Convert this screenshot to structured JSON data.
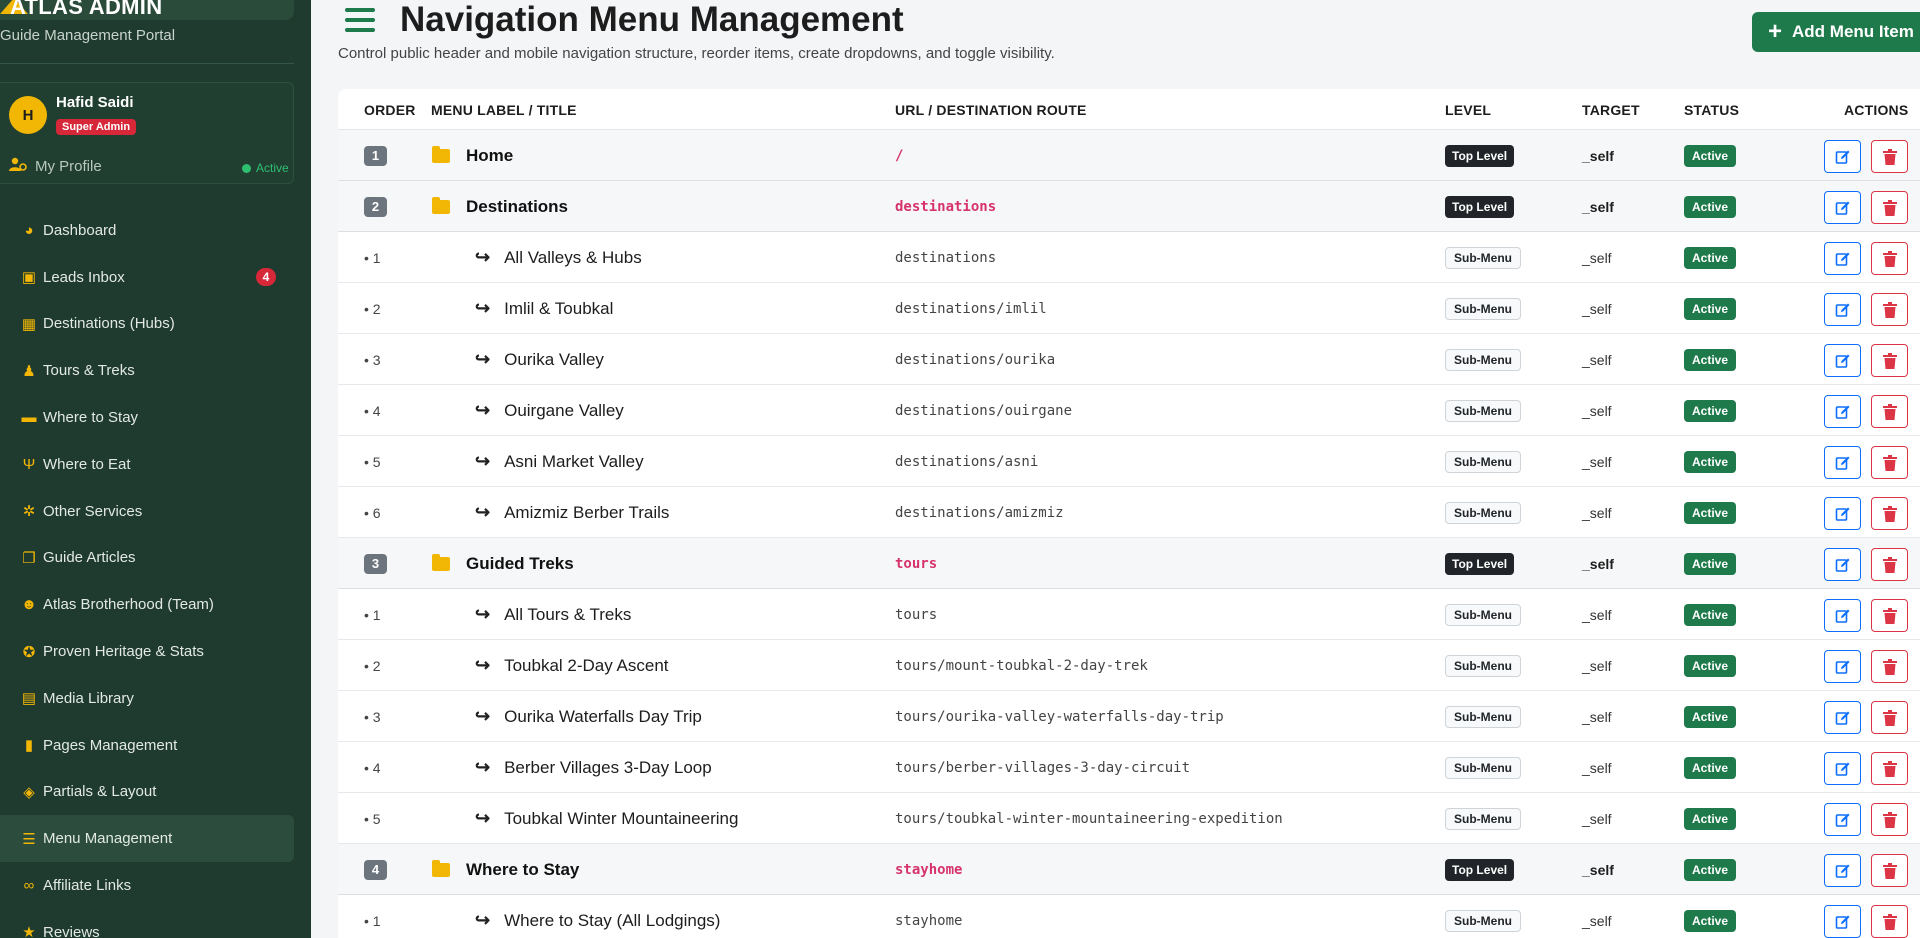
{
  "sidebar": {
    "brand": "ATLAS ADMIN",
    "subtitle": "Guide Management Portal",
    "profile": {
      "initial": "H",
      "name": "Hafid Saidi",
      "role": "Super Admin",
      "link": "My Profile",
      "status": "Active"
    },
    "items": [
      {
        "label": "Dashboard",
        "icon": "palette-icon"
      },
      {
        "label": "Leads Inbox",
        "icon": "inbox-icon",
        "badge": "4"
      },
      {
        "label": "Destinations (Hubs)",
        "icon": "map-icon"
      },
      {
        "label": "Tours & Treks",
        "icon": "hiker-icon"
      },
      {
        "label": "Where to Stay",
        "icon": "bed-icon"
      },
      {
        "label": "Where to Eat",
        "icon": "utensils-icon"
      },
      {
        "label": "Other Services",
        "icon": "cogs-icon"
      },
      {
        "label": "Guide Articles",
        "icon": "book-icon"
      },
      {
        "label": "Atlas Brotherhood (Team)",
        "icon": "users-icon"
      },
      {
        "label": "Proven Heritage & Stats",
        "icon": "award-icon"
      },
      {
        "label": "Media Library",
        "icon": "images-icon"
      },
      {
        "label": "Pages Management",
        "icon": "file-icon"
      },
      {
        "label": "Partials & Layout",
        "icon": "shapes-icon"
      },
      {
        "label": "Menu Management",
        "icon": "bars-icon",
        "active": true
      },
      {
        "label": "Affiliate Links",
        "icon": "link-icon"
      },
      {
        "label": "Reviews",
        "icon": "star-icon"
      }
    ]
  },
  "header": {
    "title": "Navigation Menu Management",
    "description": "Control public header and mobile navigation structure, reorder items, create dropdowns, and toggle visibility.",
    "add_button": "Add Menu Item"
  },
  "table": {
    "columns": {
      "order": "ORDER",
      "label": "MENU LABEL / TITLE",
      "url": "URL / DESTINATION ROUTE",
      "level": "LEVEL",
      "target": "TARGET",
      "status": "STATUS",
      "actions": "ACTIONS"
    },
    "rows": [
      {
        "order": "1",
        "label": "Home",
        "url": "/",
        "level": "Top Level",
        "target": "_self",
        "status": "Active",
        "top": true
      },
      {
        "order": "2",
        "label": "Destinations",
        "url": "destinations",
        "level": "Top Level",
        "target": "_self",
        "status": "Active",
        "top": true
      },
      {
        "order": "• 1",
        "label": "All Valleys & Hubs",
        "url": "destinations",
        "level": "Sub-Menu",
        "target": "_self",
        "status": "Active",
        "top": false
      },
      {
        "order": "• 2",
        "label": "Imlil & Toubkal",
        "url": "destinations/imlil",
        "level": "Sub-Menu",
        "target": "_self",
        "status": "Active",
        "top": false
      },
      {
        "order": "• 3",
        "label": "Ourika Valley",
        "url": "destinations/ourika",
        "level": "Sub-Menu",
        "target": "_self",
        "status": "Active",
        "top": false
      },
      {
        "order": "• 4",
        "label": "Ouirgane Valley",
        "url": "destinations/ouirgane",
        "level": "Sub-Menu",
        "target": "_self",
        "status": "Active",
        "top": false
      },
      {
        "order": "• 5",
        "label": "Asni Market Valley",
        "url": "destinations/asni",
        "level": "Sub-Menu",
        "target": "_self",
        "status": "Active",
        "top": false
      },
      {
        "order": "• 6",
        "label": "Amizmiz Berber Trails",
        "url": "destinations/amizmiz",
        "level": "Sub-Menu",
        "target": "_self",
        "status": "Active",
        "top": false
      },
      {
        "order": "3",
        "label": "Guided Treks",
        "url": "tours",
        "level": "Top Level",
        "target": "_self",
        "status": "Active",
        "top": true
      },
      {
        "order": "• 1",
        "label": "All Tours & Treks",
        "url": "tours",
        "level": "Sub-Menu",
        "target": "_self",
        "status": "Active",
        "top": false
      },
      {
        "order": "• 2",
        "label": "Toubkal 2-Day Ascent",
        "url": "tours/mount-toubkal-2-day-trek",
        "level": "Sub-Menu",
        "target": "_self",
        "status": "Active",
        "top": false
      },
      {
        "order": "• 3",
        "label": "Ourika Waterfalls Day Trip",
        "url": "tours/ourika-valley-waterfalls-day-trip",
        "level": "Sub-Menu",
        "target": "_self",
        "status": "Active",
        "top": false
      },
      {
        "order": "• 4",
        "label": "Berber Villages 3-Day Loop",
        "url": "tours/berber-villages-3-day-circuit",
        "level": "Sub-Menu",
        "target": "_self",
        "status": "Active",
        "top": false
      },
      {
        "order": "• 5",
        "label": "Toubkal Winter Mountaineering",
        "url": "tours/toubkal-winter-mountaineering-expedition",
        "level": "Sub-Menu",
        "target": "_self",
        "status": "Active",
        "top": false
      },
      {
        "order": "4",
        "label": "Where to Stay",
        "url": "stayhome",
        "level": "Top Level",
        "target": "_self",
        "status": "Active",
        "top": true
      },
      {
        "order": "• 1",
        "label": "Where to Stay (All Lodgings)",
        "url": "stayhome",
        "level": "Sub-Menu",
        "target": "_self",
        "status": "Active",
        "top": false
      }
    ]
  },
  "colors": {
    "sidebar_bg": "#1f3a2e",
    "accent_green": "#1e7a4a",
    "accent_yellow": "#f2b705",
    "danger": "#dc3545",
    "primary": "#0d6efd"
  }
}
